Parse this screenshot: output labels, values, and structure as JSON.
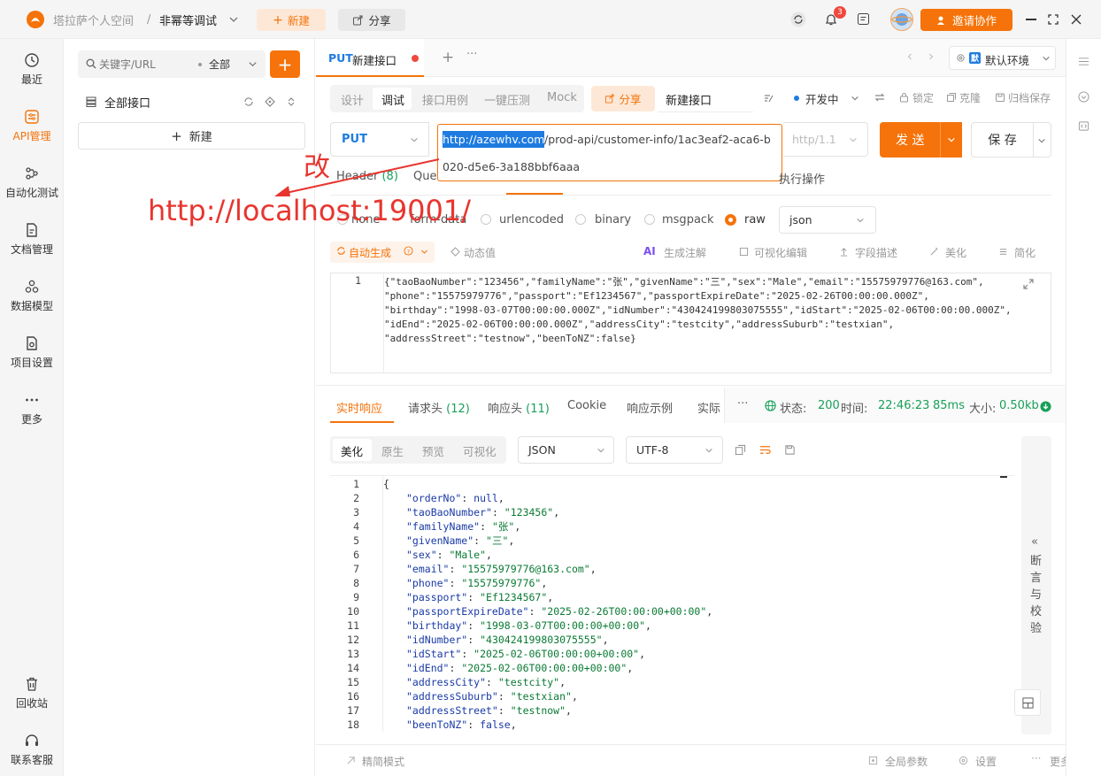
{
  "topbar": {
    "app_name": "塔拉萨个人空间",
    "sep": "/",
    "project": "非幂等调试",
    "new_label": "新建",
    "share_label": "分享",
    "notify_count": "3",
    "invite_label": "邀请协作"
  },
  "leftnav": {
    "items": [
      {
        "label": "最近"
      },
      {
        "label": "API管理"
      },
      {
        "label": "自动化测试"
      },
      {
        "label": "文档管理"
      },
      {
        "label": "数据模型"
      },
      {
        "label": "项目设置"
      },
      {
        "label": "更多"
      }
    ],
    "trash": "回收站",
    "support": "联系客服"
  },
  "tree": {
    "search_placeholder": "关键字/URL",
    "filter": "全部",
    "root": "全部接口",
    "new_label": "新建"
  },
  "tabs": {
    "active_method": "PUT",
    "active_title": "新建接口",
    "env": "默认环境"
  },
  "subtabs": {
    "items": [
      "设计",
      "调试",
      "接口用例",
      "一键压测",
      "Mock"
    ],
    "share": "分享",
    "name": "新建接口",
    "env_status": "开发中",
    "lock": "锁定",
    "clone": "克隆",
    "archive": "归档保存"
  },
  "request": {
    "method": "PUT",
    "url_highlight": "http://azewhv.com",
    "url_rest": "/prod-api/customer-info/1ac3eaf2-aca6-b",
    "url_line2": "020-d5e6-3a188bbf6aaa",
    "protocol": "http/1.1",
    "send": "发 送",
    "save": "保 存"
  },
  "annotation": {
    "change": "改",
    "new_url": "http://localhost:19001/"
  },
  "param_tabs": {
    "header": "Header",
    "header_count": "(8)",
    "query": "Que",
    "post_ops": "执行操作"
  },
  "body_types": [
    "none",
    "form-data",
    "urlencoded",
    "binary",
    "msgpack",
    "raw"
  ],
  "body_format": "json",
  "body_toolbar": {
    "auto": "自动生成",
    "dynamic": "动态值",
    "ai": "AI",
    "gen_comment": "生成注解",
    "visual_edit": "可视化编辑",
    "field_desc": "字段描述",
    "beautify": "美化",
    "simplify": "简化"
  },
  "request_body": {
    "line_no": "1",
    "lines": [
      "{\"taoBaoNumber\":\"123456\",\"familyName\":\"张\",\"givenName\":\"三\",\"sex\":\"Male\",\"email\":\"15575979776@163.com\",",
      "\"phone\":\"15575979776\",\"passport\":\"Ef1234567\",\"passportExpireDate\":\"2025-02-26T00:00:00.000Z\",",
      "\"birthday\":\"1998-03-07T00:00:00.000Z\",\"idNumber\":\"430424199803075555\",\"idStart\":\"2025-02-06T00:00:00.000Z\",",
      "\"idEnd\":\"2025-02-06T00:00:00.000Z\",\"addressCity\":\"testcity\",\"addressSuburb\":\"testxian\",",
      "\"addressStreet\":\"testnow\",\"beenToNZ\":false}"
    ]
  },
  "response_tabs": {
    "items": [
      "实时响应",
      "请求头",
      "响应头",
      "Cookie",
      "响应示例",
      "实际"
    ],
    "req_count": "(12)",
    "resp_count": "(11)",
    "more": "···",
    "status_label": "状态:",
    "status": "200",
    "time_label": "时间:",
    "time": "22:46:23",
    "duration": "85ms",
    "size_label": "大小:",
    "size": "0.50kb"
  },
  "response_view": {
    "modes": [
      "美化",
      "原生",
      "预览",
      "可视化"
    ],
    "format": "JSON",
    "encoding": "UTF-8",
    "assert_panel": [
      "断",
      "言",
      "与",
      "校",
      "验"
    ]
  },
  "response_body": [
    {
      "n": "1",
      "t": "{"
    },
    {
      "n": "2",
      "k": "\"orderNo\"",
      "v": "null",
      "kind": "kw"
    },
    {
      "n": "3",
      "k": "\"taoBaoNumber\"",
      "v": "\"123456\""
    },
    {
      "n": "4",
      "k": "\"familyName\"",
      "v": "\"张\""
    },
    {
      "n": "5",
      "k": "\"givenName\"",
      "v": "\"三\""
    },
    {
      "n": "6",
      "k": "\"sex\"",
      "v": "\"Male\""
    },
    {
      "n": "7",
      "k": "\"email\"",
      "v": "\"15575979776@163.com\""
    },
    {
      "n": "8",
      "k": "\"phone\"",
      "v": "\"15575979776\""
    },
    {
      "n": "9",
      "k": "\"passport\"",
      "v": "\"Ef1234567\""
    },
    {
      "n": "10",
      "k": "\"passportExpireDate\"",
      "v": "\"2025-02-26T00:00:00+00:00\""
    },
    {
      "n": "11",
      "k": "\"birthday\"",
      "v": "\"1998-03-07T00:00:00+00:00\""
    },
    {
      "n": "12",
      "k": "\"idNumber\"",
      "v": "\"430424199803075555\""
    },
    {
      "n": "13",
      "k": "\"idStart\"",
      "v": "\"2025-02-06T00:00:00+00:00\""
    },
    {
      "n": "14",
      "k": "\"idEnd\"",
      "v": "\"2025-02-06T00:00:00+00:00\""
    },
    {
      "n": "15",
      "k": "\"addressCity\"",
      "v": "\"testcity\""
    },
    {
      "n": "16",
      "k": "\"addressSuburb\"",
      "v": "\"testxian\""
    },
    {
      "n": "17",
      "k": "\"addressStreet\"",
      "v": "\"testnow\""
    },
    {
      "n": "18",
      "k": "\"beenToNZ\"",
      "v": "false",
      "kind": "kw"
    }
  ],
  "footer": {
    "compact": "精简模式",
    "global_params": "全局参数",
    "settings": "设置",
    "more": "更多"
  },
  "colors": {
    "accent": "#f5730a",
    "url_highlight": "#1e7be0",
    "annotation": "#e8352f",
    "success": "#18a058"
  }
}
